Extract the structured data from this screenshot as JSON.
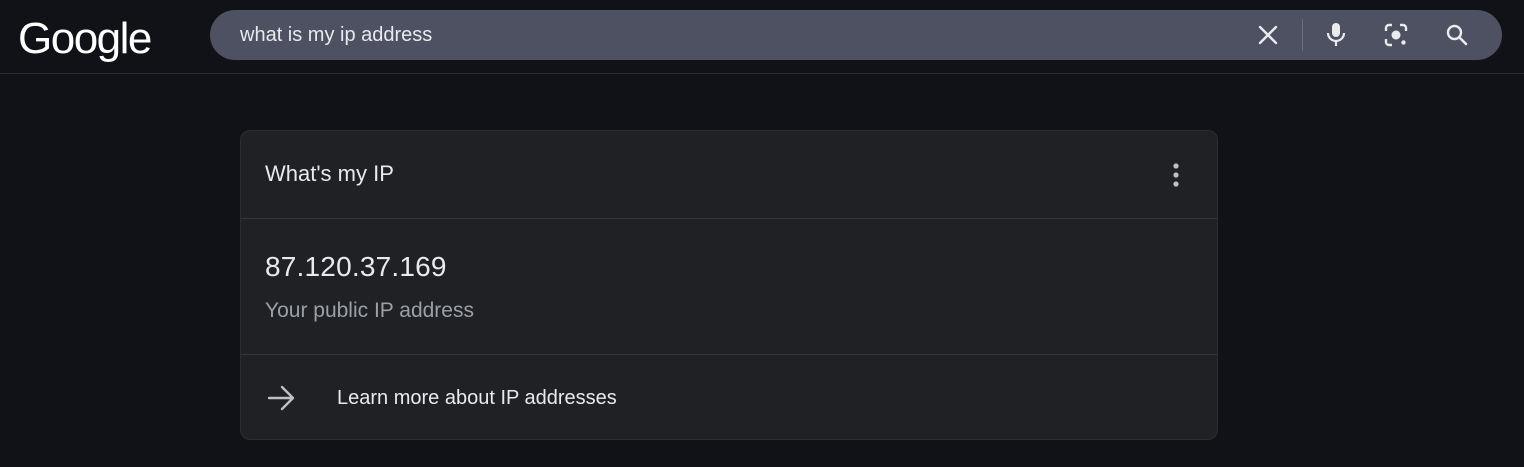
{
  "header": {
    "logo_text": "Google",
    "search": {
      "value": "what is my ip address",
      "clear_icon": "close-icon",
      "voice_icon": "microphone-icon",
      "lens_icon": "camera-lens-icon",
      "search_icon": "search-icon"
    }
  },
  "card": {
    "title": "What's my IP",
    "menu_icon": "more-vertical-icon",
    "ip": "87.120.37.169",
    "caption": "Your public IP address",
    "link_icon": "arrow-right-icon",
    "link_text": "Learn more about IP addresses"
  },
  "colors": {
    "page_background": "#101218",
    "searchbox_background": "#4d5161",
    "card_background": "#202124",
    "primary_text": "#e8eaed",
    "secondary_text": "#9aa0a6"
  }
}
